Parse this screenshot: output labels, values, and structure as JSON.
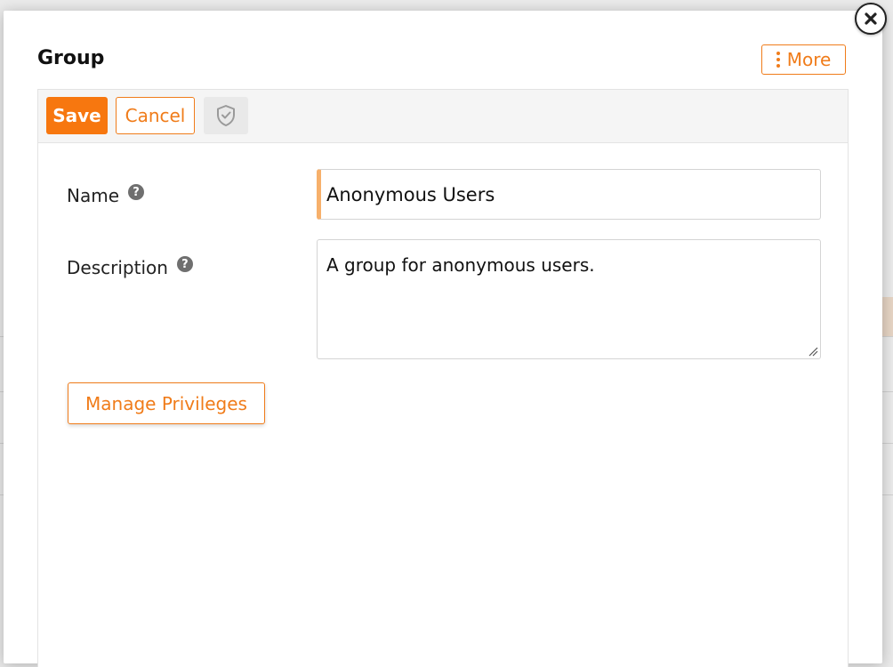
{
  "modal": {
    "title": "Group",
    "more_label": "More",
    "close_icon": "close-icon"
  },
  "toolbar": {
    "save_label": "Save",
    "cancel_label": "Cancel",
    "shield_icon": "shield-check-icon"
  },
  "form": {
    "name_label": "Name",
    "name_value": "Anonymous Users",
    "description_label": "Description",
    "description_value": "A group for anonymous users.",
    "help_glyph": "?"
  },
  "actions": {
    "manage_privileges_label": "Manage Privileges"
  },
  "colors": {
    "accent": "#f07c1a",
    "save_bg": "#f7770f",
    "input_focus_bar": "#f7b06b"
  }
}
